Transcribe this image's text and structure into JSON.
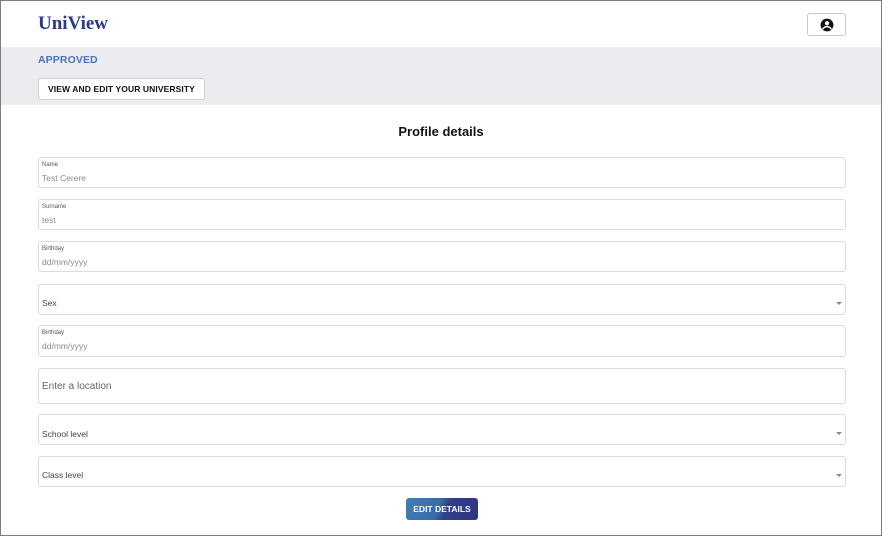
{
  "header": {
    "logo": "UniView",
    "account_icon": "account-circle-icon"
  },
  "banner": {
    "status": "APPROVED",
    "university_button": "VIEW AND EDIT YOUR UNIVERSITY"
  },
  "form": {
    "title": "Profile details",
    "fields": [
      {
        "label": "Name",
        "value": "Test Cerere"
      },
      {
        "label": "Surname",
        "value": "test"
      },
      {
        "label": "Birthday",
        "value": "dd/mm/yyyy"
      },
      {
        "placeholder": "Sex"
      },
      {
        "label": "Birthday",
        "value": "dd/mm/yyyy"
      },
      {
        "placeholder": "Enter a location"
      },
      {
        "placeholder": "School level"
      },
      {
        "placeholder": "Class level"
      }
    ],
    "submit": "EDIT DETAILS"
  },
  "colors": {
    "brand": "#2b3a86",
    "status": "#4a74b8",
    "banner_bg": "#ebebf0",
    "button_gradient": [
      "#3d7fb8",
      "#2d3582"
    ]
  }
}
